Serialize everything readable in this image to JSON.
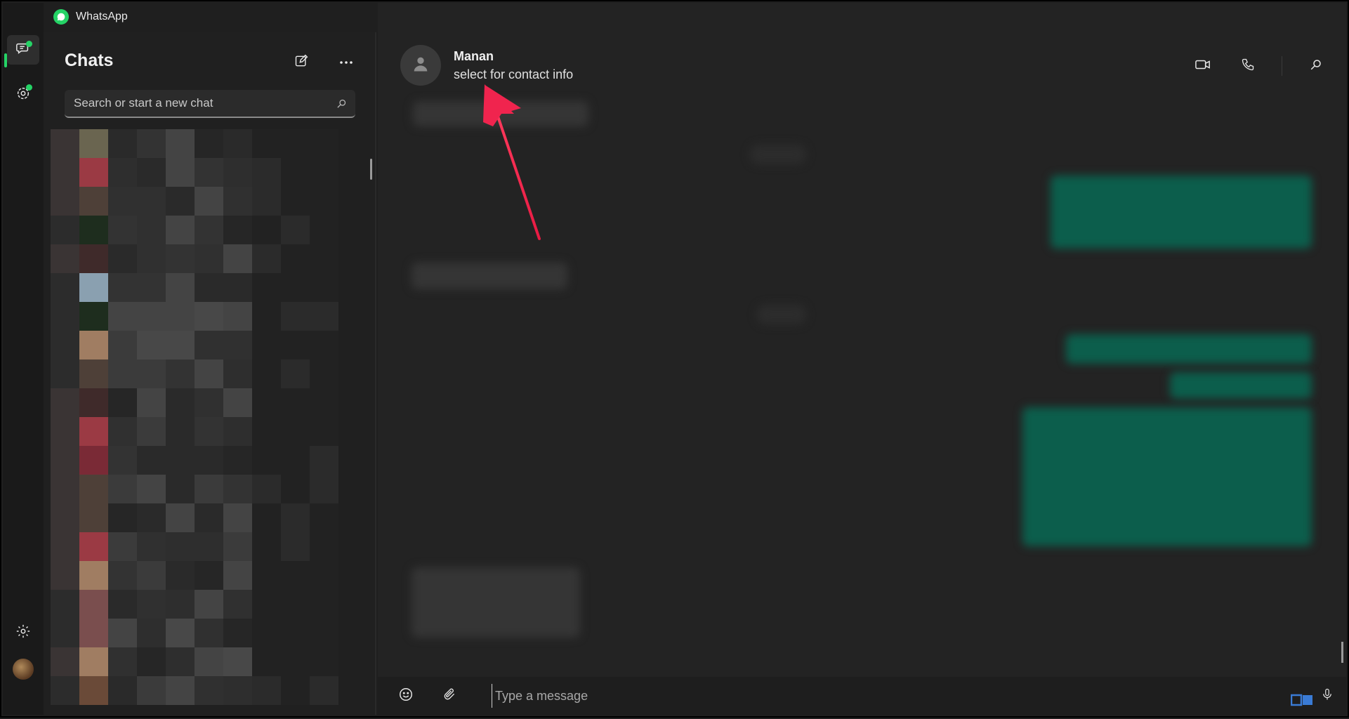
{
  "window": {
    "app_title": "WhatsApp",
    "controls": [
      "minimize-icon",
      "restore-icon",
      "close-icon"
    ]
  },
  "rail": {
    "items": [
      {
        "name": "chats-icon",
        "active": true,
        "badge": true
      },
      {
        "name": "status-icon",
        "active": false,
        "badge": true
      }
    ],
    "bottom": [
      "settings-icon",
      "profile-avatar"
    ]
  },
  "chat_list": {
    "title": "Chats",
    "new_chat_icon": "new-chat-icon",
    "menu_icon": "more-options-icon",
    "search": {
      "placeholder": "Search or start a new chat",
      "value": ""
    }
  },
  "conversation": {
    "contact_name": "Manan",
    "contact_subtitle": "select for contact info",
    "header_actions": [
      "video-call-icon",
      "voice-call-icon",
      "search-icon"
    ],
    "composer": {
      "placeholder": "Type a message",
      "value": ""
    }
  },
  "colors": {
    "accent": "#25d366",
    "annotation_arrow": "#f0244e",
    "outgoing_bubble": "#0c5e4c",
    "incoming_bubble": "#353535"
  }
}
